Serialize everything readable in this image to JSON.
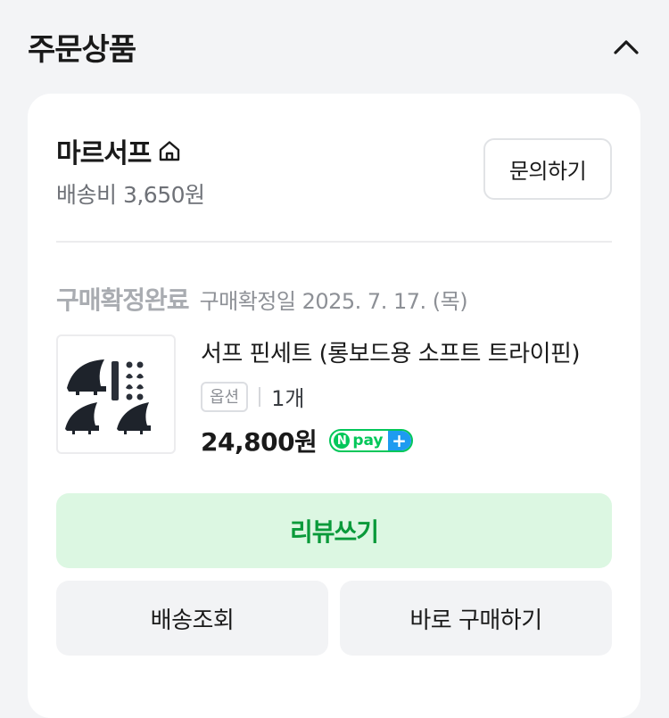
{
  "section": {
    "title": "주문상품",
    "collapse_icon": "chevron-up-icon"
  },
  "seller": {
    "name": "마르서프",
    "store_icon": "home-icon",
    "shipping_fee": "배송비 3,650원",
    "inquiry_label": "문의하기"
  },
  "order": {
    "status": "구매확정완료",
    "confirmed_date": "구매확정일 2025. 7. 17. (목)"
  },
  "product": {
    "name": "서프 핀세트 (롱보드용 소프트 트라이핀)",
    "option_label": "옵션",
    "quantity": "1개",
    "price": "24,800원",
    "npay": {
      "n": "N",
      "text": "pay",
      "plus": "+"
    }
  },
  "actions": {
    "review": "리뷰쓰기",
    "track": "배송조회",
    "rebuy": "바로 구매하기"
  },
  "colors": {
    "review_bg": "#dcf7e2",
    "review_text": "#0a9a3a",
    "npay_green": "#03c75a",
    "npay_blue": "#1e9bf0"
  }
}
